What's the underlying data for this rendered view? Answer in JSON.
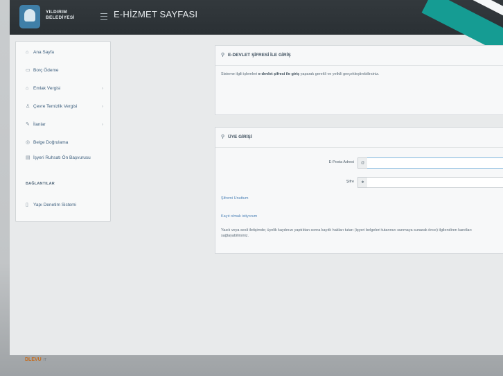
{
  "header": {
    "logo_line1": "YILDIRIM",
    "logo_line2": "BELEDİYESİ",
    "title": "E-HİZMET SAYFASI"
  },
  "sidebar": {
    "items": [
      {
        "label": "Ana Sayfa",
        "icon": "home-icon"
      },
      {
        "label": "Borç Ödeme",
        "icon": "credit-card-icon"
      },
      {
        "label": "Emlak Vergisi",
        "icon": "building-icon",
        "arrow": "›"
      },
      {
        "label": "Çevre Temizlik Vergisi",
        "icon": "broom-icon",
        "arrow": "›"
      },
      {
        "label": "İlanlar",
        "icon": "pencil-icon",
        "arrow": "›"
      },
      {
        "label": "Belge Doğrulama",
        "icon": "check-circle-icon"
      },
      {
        "label": "İşyeri Ruhsatı Ön Başvurusu",
        "icon": "document-icon"
      }
    ],
    "section_title": "BAĞLANTILAR",
    "links": [
      {
        "label": "Yapı Denetim Sistemi",
        "icon": "document-icon"
      }
    ]
  },
  "edevlet_panel": {
    "title": "E-DEVLET ŞİFRESİ İLE GİRİŞ",
    "text_before": "Sisteme ilgili işlemleri ",
    "text_bold": "e-devlet şifresi ile giriş",
    "text_after": " yaparak gerekli ve yetkili gerçekleştirebilirsiniz."
  },
  "member_panel": {
    "title": "ÜYE GİRİŞİ",
    "email_label": "E-Posta Adresi",
    "password_label": "Şifre",
    "forgot_link": "Şifremi Unuttum",
    "register_link": "Kayıt olmak istiyorum",
    "note": "Yazılı veya sesli iletişimde; üyelik kaydınızı yaptıktan sonra kayıtlı hakları tutarı (işyeri belgeleri tutarınızı sunmaya sunarak önce) ilgilendiren kanıtları sağlayabilirsiniz."
  },
  "footer": {
    "brand": "DLEVU",
    "sub": "IT"
  },
  "colors": {
    "topbar": "#2f353a",
    "accent_teal": "#159c93",
    "link": "#4f84b8"
  }
}
